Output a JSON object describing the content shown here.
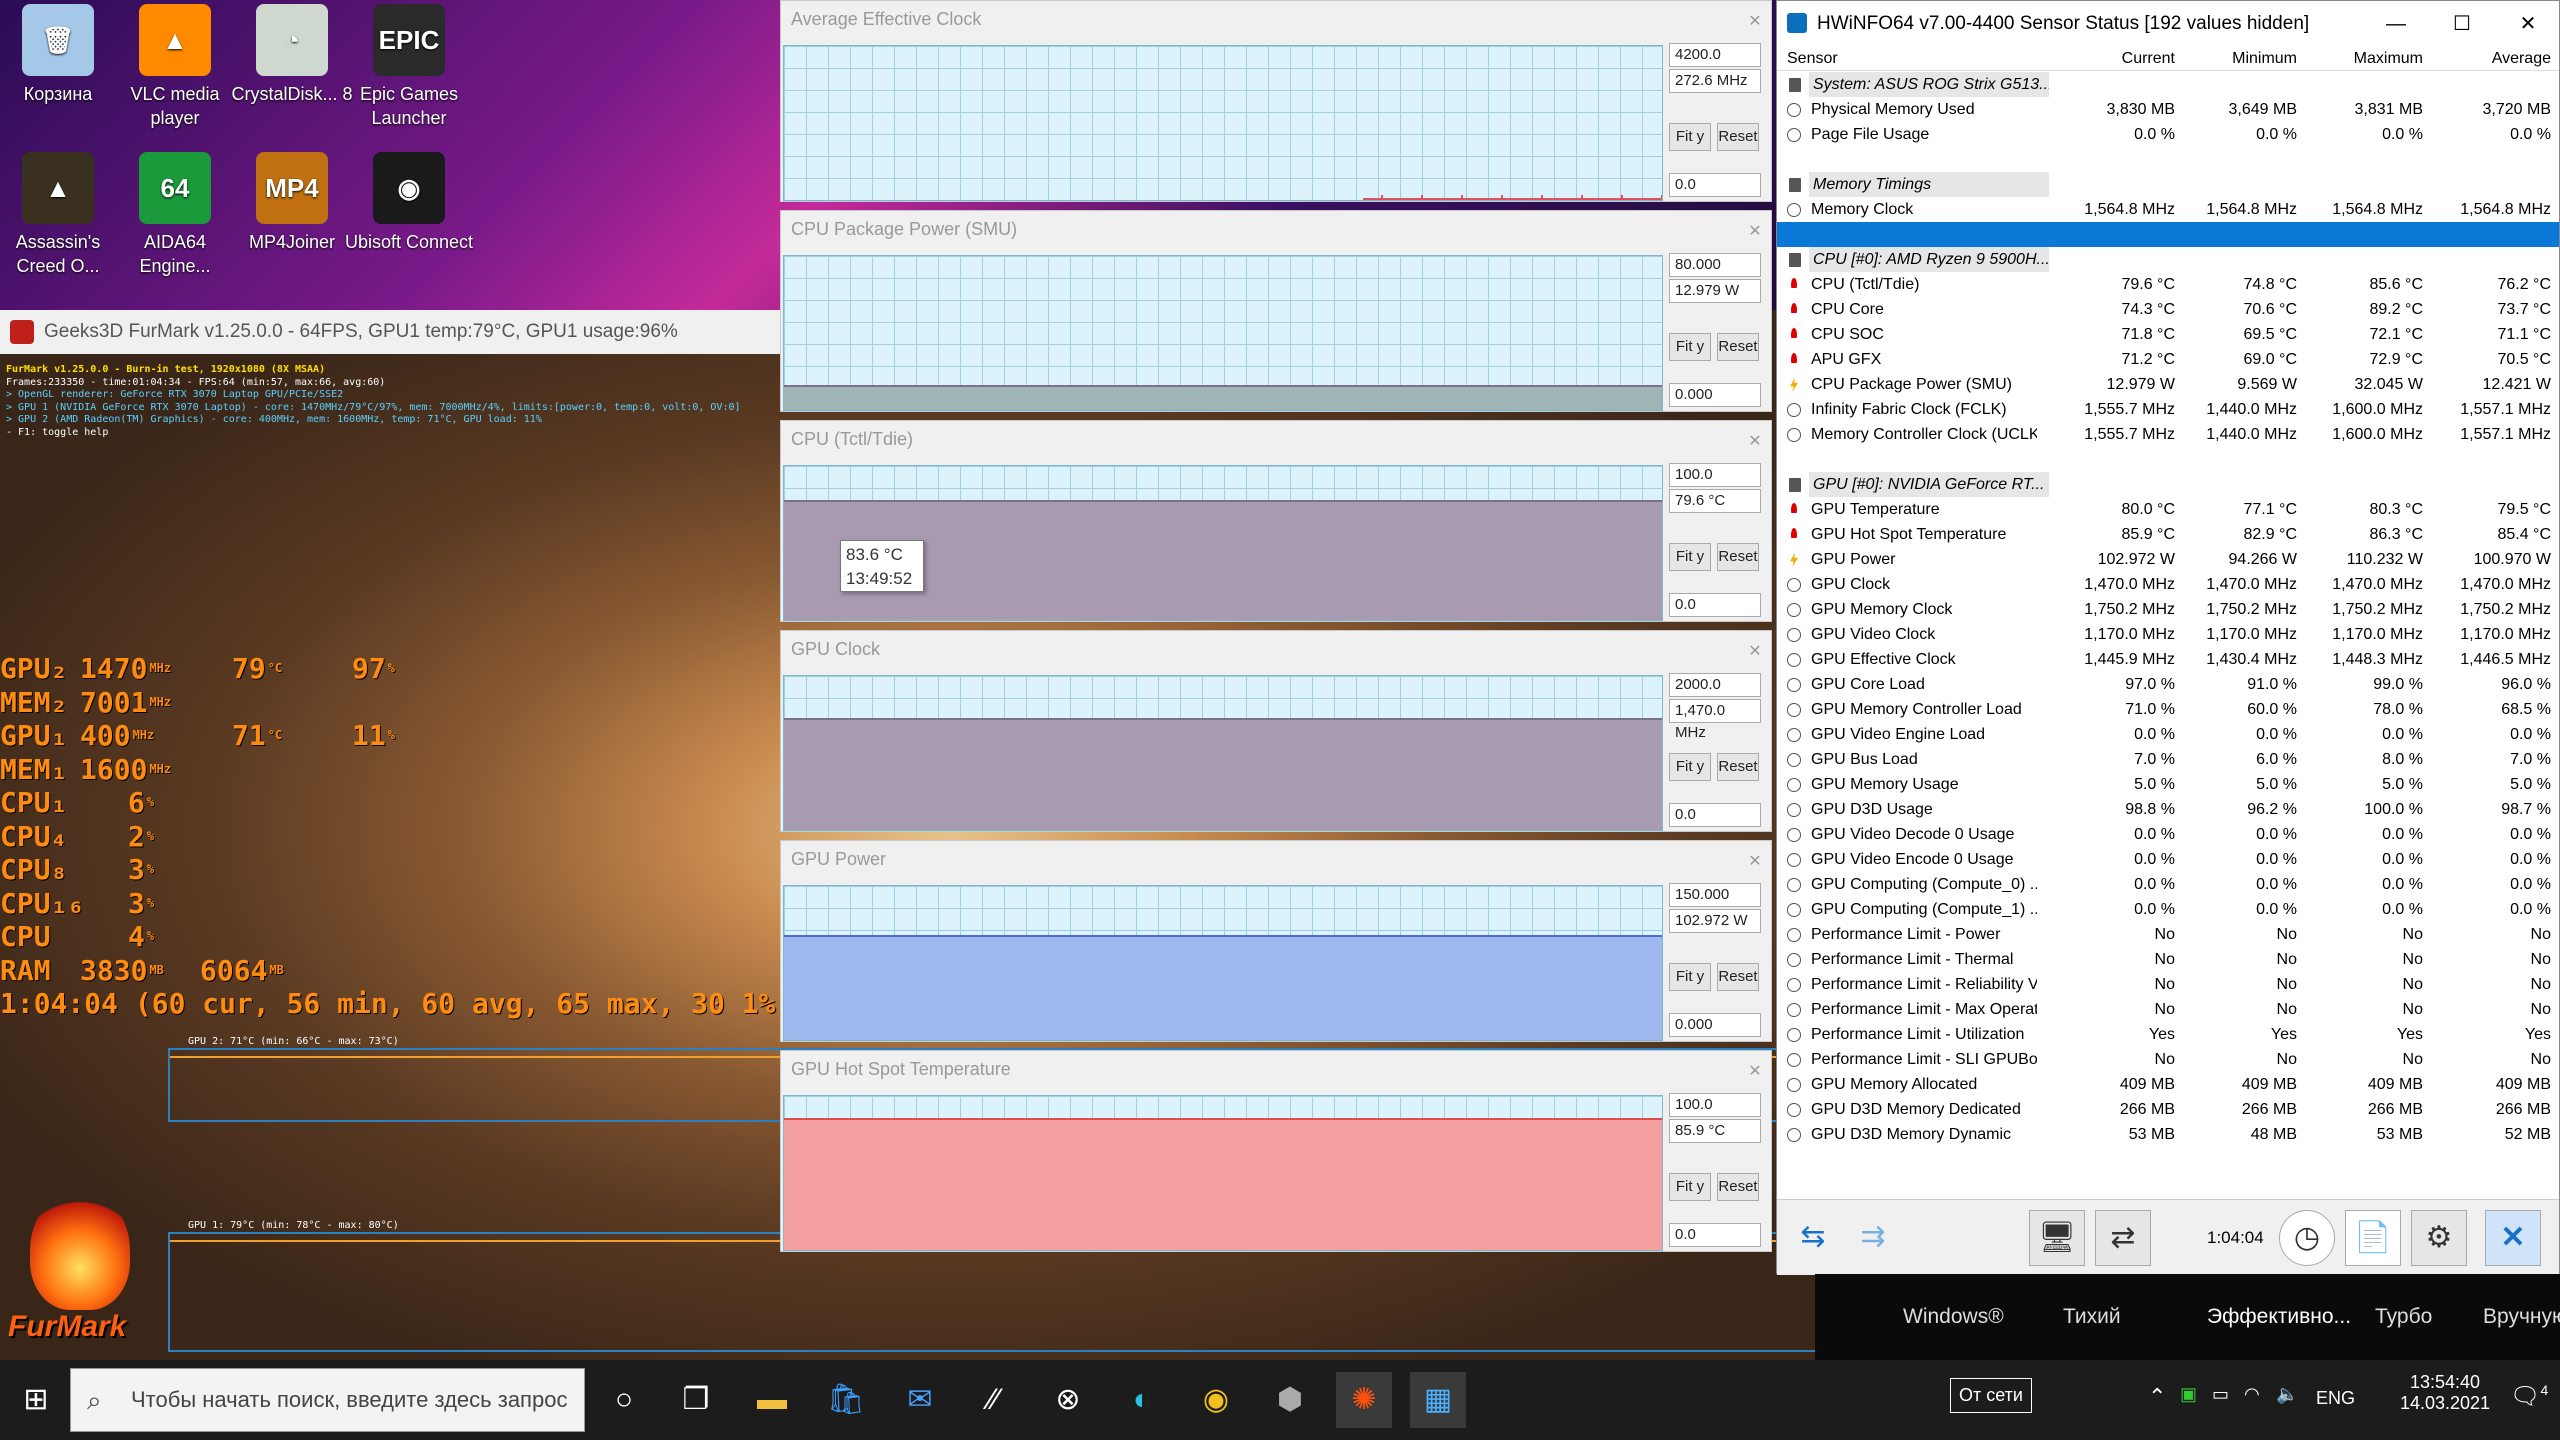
{
  "desktop": {
    "icons": [
      {
        "label": "Корзина",
        "glyph": "🗑",
        "color": "#a6c8e8"
      },
      {
        "label": "VLC media player",
        "glyph": "▲",
        "color": "#ff8a00"
      },
      {
        "label": "CrystalDisk... 8",
        "glyph": "◔",
        "color": "#cfd8cf"
      },
      {
        "label": "Epic Games Launcher",
        "glyph": "EPIC",
        "color": "#2a2a2a"
      },
      {
        "label": "Assassin's Creed O...",
        "glyph": "▲",
        "color": "#3a3020"
      },
      {
        "label": "AIDA64 Engine...",
        "glyph": "64",
        "color": "#1a9a3a"
      },
      {
        "label": "MP4Joiner",
        "glyph": "MP4",
        "color": "#c07010"
      },
      {
        "label": "Ubisoft Connect",
        "glyph": "◉",
        "color": "#1a1a1a"
      }
    ]
  },
  "furmark": {
    "title": "Geeks3D FurMark v1.25.0.0 - 64FPS, GPU1 temp:79°C, GPU1 usage:96%",
    "info": [
      "FurMark v1.25.0.0 - Burn-in test, 1920x1080 (8X MSAA)",
      "Frames:233350 - time:01:04:34 - FPS:64 (min:57, max:66, avg:60)",
      "> OpenGL renderer: GeForce RTX 3070 Laptop GPU/PCIe/SSE2",
      "> GPU 1 (NVIDIA GeForce RTX 3070 Laptop) - core: 1470MHz/79°C/97%, mem: 7000MHz/4%, limits:[power:0, temp:0, volt:0, OV:0]",
      "> GPU 2 (AMD Radeon(TM) Graphics) - core: 400MHz, mem: 1600MHz, temp: 71°C, GPU load: 11%",
      "- F1: toggle help"
    ],
    "osd": [
      {
        "label": "GPU₂",
        "v1": "1470",
        "u1": "MHz",
        "v2": "79",
        "u2": "°C",
        "v3": "97",
        "u3": "%"
      },
      {
        "label": "MEM₂",
        "v1": "7001",
        "u1": "MHz",
        "v2": "",
        "u2": "",
        "v3": "",
        "u3": ""
      },
      {
        "label": "GPU₁",
        "v1": "400",
        "u1": "MHz",
        "v2": "71",
        "u2": "°C",
        "v3": "11",
        "u3": "%"
      },
      {
        "label": "MEM₁",
        "v1": "1600",
        "u1": "MHz",
        "v2": "",
        "u2": "",
        "v3": "",
        "u3": ""
      },
      {
        "label": "CPU₁",
        "v1": "6",
        "u1": "%",
        "v2": "",
        "u2": "",
        "v3": "",
        "u3": ""
      },
      {
        "label": "CPU₄",
        "v1": "2",
        "u1": "%",
        "v2": "",
        "u2": "",
        "v3": "",
        "u3": ""
      },
      {
        "label": "CPU₈",
        "v1": "3",
        "u1": "%",
        "v2": "",
        "u2": "",
        "v3": "",
        "u3": ""
      },
      {
        "label": "CPU₁₆",
        "v1": "3",
        "u1": "%",
        "v2": "",
        "u2": "",
        "v3": "",
        "u3": ""
      },
      {
        "label": "CPU",
        "v1": "4",
        "u1": "%",
        "v2": "",
        "u2": "",
        "v3": "",
        "u3": ""
      },
      {
        "label": "RAM",
        "v1": "3830",
        "u1": "MB",
        "v2": "6064",
        "u2": "MB",
        "v3": "",
        "u3": ""
      }
    ],
    "fps_line": "1:04:04 (60 cur, 56 min, 60 avg, 65 max, 30 1% lo",
    "graph1_label": "GPU 2: 71°C (min: 66°C - max: 73°C)",
    "graph2_label": "GPU 1: 79°C (min: 78°C - max: 80°C)",
    "logo": "FurMark"
  },
  "graphs": [
    {
      "title": "Average Effective Clock",
      "max": "4200.0",
      "current": "272.6 MHz",
      "min": "0.0",
      "fill": 0.03,
      "color": "#e05060",
      "mode": "spiky"
    },
    {
      "title": "CPU Package Power (SMU)",
      "max": "80.000",
      "current": "12.979 W",
      "min": "0.000",
      "fill": 0.16,
      "color": "#9fb4b4",
      "mode": "flat"
    },
    {
      "title": "CPU (Tctl/Tdie)",
      "max": "100.0",
      "current": "79.6 °C",
      "min": "0.0",
      "fill": 0.78,
      "color": "#a89ab0",
      "mode": "flat"
    },
    {
      "title": "GPU Clock",
      "max": "2000.0",
      "current": "1,470.0 MHz",
      "min": "0.0",
      "fill": 0.73,
      "color": "#a89ab0",
      "mode": "flat"
    },
    {
      "title": "GPU Power",
      "max": "150.000",
      "current": "102.972 W",
      "min": "0.000",
      "fill": 0.68,
      "color": "#9fb8ee",
      "mode": "flat"
    },
    {
      "title": "GPU Hot Spot Temperature",
      "max": "100.0",
      "current": "85.9 °C",
      "min": "0.0",
      "fill": 0.86,
      "color": "#f5a0a0",
      "mode": "flat"
    }
  ],
  "graph_buttons": {
    "fit": "Fit y",
    "reset": "Reset"
  },
  "tooltip": {
    "value": "83.6 °C",
    "time": "13:49:52"
  },
  "hwinfo": {
    "title": "HWiNFO64 v7.00-4400 Sensor Status [192 values hidden]",
    "headers": [
      "Sensor",
      "Current",
      "Minimum",
      "Maximum",
      "Average"
    ],
    "rows": [
      {
        "t": "grp",
        "n": "System: ASUS ROG Strix G513..."
      },
      {
        "t": "c",
        "n": "Physical Memory Used",
        "v": [
          "3,830 MB",
          "3,649 MB",
          "3,831 MB",
          "3,720 MB"
        ]
      },
      {
        "t": "c",
        "n": "Page File Usage",
        "v": [
          "0.0 %",
          "0.0 %",
          "0.0 %",
          "0.0 %"
        ]
      },
      {
        "t": "blank"
      },
      {
        "t": "grp",
        "n": "Memory Timings"
      },
      {
        "t": "c",
        "n": "Memory Clock",
        "v": [
          "1,564.8 MHz",
          "1,564.8 MHz",
          "1,564.8 MHz",
          "1,564.8 MHz"
        ]
      },
      {
        "t": "sel"
      },
      {
        "t": "grp",
        "n": "CPU [#0]: AMD Ryzen 9 5900H..."
      },
      {
        "t": "temp",
        "n": "CPU (Tctl/Tdie)",
        "v": [
          "79.6 °C",
          "74.8 °C",
          "85.6 °C",
          "76.2 °C"
        ]
      },
      {
        "t": "temp",
        "n": "CPU Core",
        "v": [
          "74.3 °C",
          "70.6 °C",
          "89.2 °C",
          "73.7 °C"
        ]
      },
      {
        "t": "temp",
        "n": "CPU SOC",
        "v": [
          "71.8 °C",
          "69.5 °C",
          "72.1 °C",
          "71.1 °C"
        ]
      },
      {
        "t": "temp",
        "n": "APU GFX",
        "v": [
          "71.2 °C",
          "69.0 °C",
          "72.9 °C",
          "70.5 °C"
        ]
      },
      {
        "t": "pow",
        "n": "CPU Package Power (SMU)",
        "v": [
          "12.979 W",
          "9.569 W",
          "32.045 W",
          "12.421 W"
        ]
      },
      {
        "t": "c",
        "n": "Infinity Fabric Clock (FCLK)",
        "v": [
          "1,555.7 MHz",
          "1,440.0 MHz",
          "1,600.0 MHz",
          "1,557.1 MHz"
        ]
      },
      {
        "t": "c",
        "n": "Memory Controller Clock (UCLK)",
        "v": [
          "1,555.7 MHz",
          "1,440.0 MHz",
          "1,600.0 MHz",
          "1,557.1 MHz"
        ]
      },
      {
        "t": "blank"
      },
      {
        "t": "grp",
        "n": "GPU [#0]: NVIDIA GeForce RT..."
      },
      {
        "t": "temp",
        "n": "GPU Temperature",
        "v": [
          "80.0 °C",
          "77.1 °C",
          "80.3 °C",
          "79.5 °C"
        ]
      },
      {
        "t": "temp",
        "n": "GPU Hot Spot Temperature",
        "v": [
          "85.9 °C",
          "82.9 °C",
          "86.3 °C",
          "85.4 °C"
        ]
      },
      {
        "t": "pow",
        "n": "GPU Power",
        "v": [
          "102.972 W",
          "94.266 W",
          "110.232 W",
          "100.970 W"
        ]
      },
      {
        "t": "c",
        "n": "GPU Clock",
        "v": [
          "1,470.0 MHz",
          "1,470.0 MHz",
          "1,470.0 MHz",
          "1,470.0 MHz"
        ]
      },
      {
        "t": "c",
        "n": "GPU Memory Clock",
        "v": [
          "1,750.2 MHz",
          "1,750.2 MHz",
          "1,750.2 MHz",
          "1,750.2 MHz"
        ]
      },
      {
        "t": "c",
        "n": "GPU Video Clock",
        "v": [
          "1,170.0 MHz",
          "1,170.0 MHz",
          "1,170.0 MHz",
          "1,170.0 MHz"
        ]
      },
      {
        "t": "c",
        "n": "GPU Effective Clock",
        "v": [
          "1,445.9 MHz",
          "1,430.4 MHz",
          "1,448.3 MHz",
          "1,446.5 MHz"
        ]
      },
      {
        "t": "c",
        "n": "GPU Core Load",
        "v": [
          "97.0 %",
          "91.0 %",
          "99.0 %",
          "96.0 %"
        ]
      },
      {
        "t": "c",
        "n": "GPU Memory Controller Load",
        "v": [
          "71.0 %",
          "60.0 %",
          "78.0 %",
          "68.5 %"
        ]
      },
      {
        "t": "c",
        "n": "GPU Video Engine Load",
        "v": [
          "0.0 %",
          "0.0 %",
          "0.0 %",
          "0.0 %"
        ]
      },
      {
        "t": "c",
        "n": "GPU Bus Load",
        "v": [
          "7.0 %",
          "6.0 %",
          "8.0 %",
          "7.0 %"
        ]
      },
      {
        "t": "c",
        "n": "GPU Memory Usage",
        "v": [
          "5.0 %",
          "5.0 %",
          "5.0 %",
          "5.0 %"
        ]
      },
      {
        "t": "c",
        "n": "GPU D3D Usage",
        "v": [
          "98.8 %",
          "96.2 %",
          "100.0 %",
          "98.7 %"
        ]
      },
      {
        "t": "c",
        "n": "GPU Video Decode 0 Usage",
        "v": [
          "0.0 %",
          "0.0 %",
          "0.0 %",
          "0.0 %"
        ]
      },
      {
        "t": "c",
        "n": "GPU Video Encode 0 Usage",
        "v": [
          "0.0 %",
          "0.0 %",
          "0.0 %",
          "0.0 %"
        ]
      },
      {
        "t": "c",
        "n": "GPU Computing (Compute_0) ...",
        "v": [
          "0.0 %",
          "0.0 %",
          "0.0 %",
          "0.0 %"
        ]
      },
      {
        "t": "c",
        "n": "GPU Computing (Compute_1) ...",
        "v": [
          "0.0 %",
          "0.0 %",
          "0.0 %",
          "0.0 %"
        ]
      },
      {
        "t": "c",
        "n": "Performance Limit - Power",
        "v": [
          "No",
          "No",
          "No",
          "No"
        ]
      },
      {
        "t": "c",
        "n": "Performance Limit - Thermal",
        "v": [
          "No",
          "No",
          "No",
          "No"
        ]
      },
      {
        "t": "c",
        "n": "Performance Limit - Reliability V...",
        "v": [
          "No",
          "No",
          "No",
          "No"
        ]
      },
      {
        "t": "c",
        "n": "Performance Limit - Max Operat...",
        "v": [
          "No",
          "No",
          "No",
          "No"
        ]
      },
      {
        "t": "c",
        "n": "Performance Limit - Utilization",
        "v": [
          "Yes",
          "Yes",
          "Yes",
          "Yes"
        ]
      },
      {
        "t": "c",
        "n": "Performance Limit - SLI GPUBo...",
        "v": [
          "No",
          "No",
          "No",
          "No"
        ]
      },
      {
        "t": "c",
        "n": "GPU Memory Allocated",
        "v": [
          "409 MB",
          "409 MB",
          "409 MB",
          "409 MB"
        ]
      },
      {
        "t": "c",
        "n": "GPU D3D Memory Dedicated",
        "v": [
          "266 MB",
          "266 MB",
          "266 MB",
          "266 MB"
        ]
      },
      {
        "t": "c",
        "n": "GPU D3D Memory Dynamic",
        "v": [
          "53 MB",
          "48 MB",
          "53 MB",
          "52 MB"
        ]
      }
    ],
    "elapsed": "1:04:04"
  },
  "profiles": [
    "Windows®",
    "Тихий",
    "Эффективно...",
    "Турбо",
    "Вручную"
  ],
  "taskbar": {
    "search_placeholder": "Чтобы начать поиск, введите здесь запрос",
    "lang": "ENG",
    "network": "От сети",
    "time": "13:54:40",
    "date": "14.03.2021",
    "notif": "4"
  }
}
